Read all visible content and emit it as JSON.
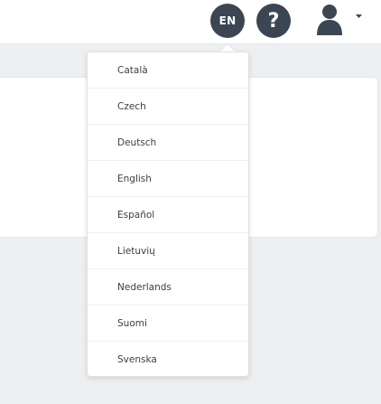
{
  "header": {
    "language_button_label": "EN",
    "help_button_label": "?",
    "icons": {
      "user": "user-icon",
      "caret": "caret-down-icon"
    }
  },
  "language_menu": {
    "items": [
      {
        "label": "Català"
      },
      {
        "label": "Czech"
      },
      {
        "label": "Deutsch"
      },
      {
        "label": "English"
      },
      {
        "label": "Español"
      },
      {
        "label": "Lietuvių"
      },
      {
        "label": "Nederlands"
      },
      {
        "label": "Suomi"
      },
      {
        "label": "Svenska"
      }
    ]
  },
  "colors": {
    "icon_dark": "#3c4653",
    "page_background": "#eeeff1",
    "surface": "#ffffff"
  }
}
